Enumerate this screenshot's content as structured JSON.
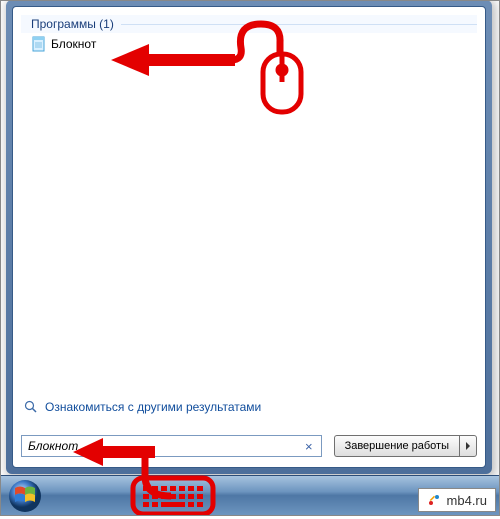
{
  "category": {
    "label": "Программы (1)"
  },
  "results": [
    {
      "label": "Блокнот"
    }
  ],
  "more_results_label": "Ознакомиться с другими результатами",
  "search": {
    "value": "Блокнот"
  },
  "shutdown": {
    "label": "Завершение работы"
  },
  "watermark": {
    "text": "mb4.ru"
  }
}
